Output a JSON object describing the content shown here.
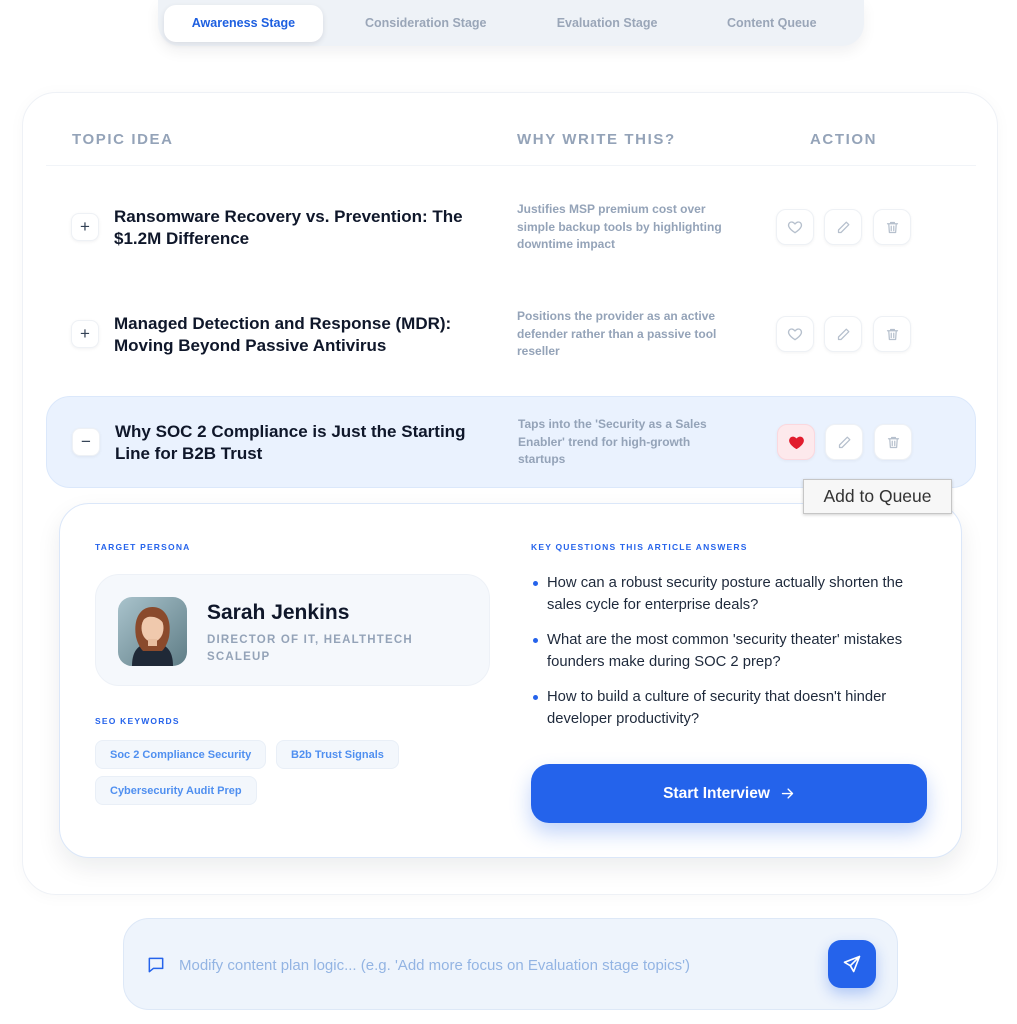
{
  "tabs": [
    {
      "label": "Awareness Stage",
      "active": true
    },
    {
      "label": "Consideration Stage",
      "active": false
    },
    {
      "label": "Evaluation Stage",
      "active": false
    },
    {
      "label": "Content Queue",
      "active": false
    }
  ],
  "table": {
    "headers": {
      "topic": "TOPIC IDEA",
      "why": "WHY WRITE THIS?",
      "action": "ACTION"
    },
    "rows": [
      {
        "toggle": "+",
        "title": "Ransomware Recovery vs. Prevention: The $1.2M Difference",
        "why": "Justifies MSP premium cost over simple backup tools by highlighting downtime impact",
        "liked": false
      },
      {
        "toggle": "+",
        "title": "Managed Detection and Response (MDR): Moving Beyond Passive Antivirus",
        "why": "Positions the provider as an active defender rather than a passive tool reseller",
        "liked": false
      },
      {
        "toggle": "−",
        "title": "Why SOC 2 Compliance is Just the Starting Line for B2B Trust",
        "why": "Taps into the 'Security as a Sales Enabler' trend for high-growth startups",
        "liked": true
      }
    ]
  },
  "tooltip": "Add to Queue",
  "detail": {
    "persona_label": "TARGET PERSONA",
    "persona": {
      "name": "Sarah Jenkins",
      "role": "DIRECTOR OF IT, HEALTHTECH SCALEUP"
    },
    "seo_label": "SEO KEYWORDS",
    "keywords": [
      "Soc 2 Compliance Security",
      "B2b Trust Signals",
      "Cybersecurity Audit Prep"
    ],
    "questions_label": "KEY QUESTIONS THIS ARTICLE ANSWERS",
    "questions": [
      "How can a robust security posture actually shorten the sales cycle for enterprise deals?",
      "What are the most common 'security theater' mistakes founders make during SOC 2 prep?",
      "How to build a culture of security that doesn't hinder developer productivity?"
    ],
    "start_button": "Start Interview",
    "start_button_icon": "arrow-right-icon"
  },
  "chat": {
    "placeholder": "Modify content plan logic... (e.g. 'Add more focus on Evaluation stage topics')",
    "value": "",
    "icon": "message-square-icon",
    "send_icon": "send-icon"
  },
  "colors": {
    "accent": "#2563eb",
    "like_active": "#e11d2e",
    "muted": "#94a3b8"
  }
}
